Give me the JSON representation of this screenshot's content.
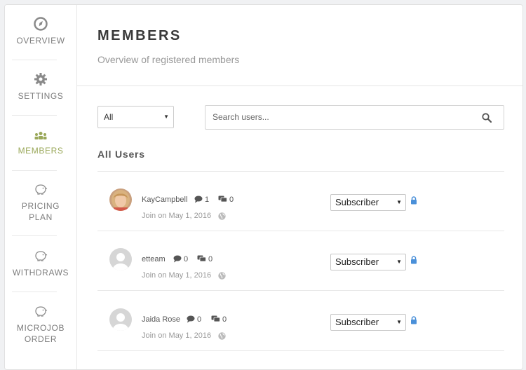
{
  "sidebar": {
    "items": [
      {
        "label": "OVERVIEW",
        "icon": "overview-icon"
      },
      {
        "label": "SETTINGS",
        "icon": "gear-icon"
      },
      {
        "label": "MEMBERS",
        "icon": "members-icon",
        "active": true
      },
      {
        "label_line1": "PRICING",
        "label_line2": "PLAN",
        "icon": "piggy-bank-icon"
      },
      {
        "label": "WITHDRAWS",
        "icon": "piggy-bank-icon"
      },
      {
        "label_line1": "MICROJOB",
        "label_line2": "ORDER",
        "icon": "piggy-bank-icon"
      }
    ]
  },
  "header": {
    "title": "MEMBERS",
    "subtitle": "Overview of registered members"
  },
  "filter": {
    "selected": "All"
  },
  "search": {
    "placeholder": "Search users..."
  },
  "section_title": "All Users",
  "users": [
    {
      "name": "KayCampbell",
      "comments": "1",
      "messages": "0",
      "joined": "Join on May 1, 2016",
      "role": "Subscriber",
      "has_photo": true
    },
    {
      "name": "etteam",
      "comments": "0",
      "messages": "0",
      "joined": "Join on May 1, 2016",
      "role": "Subscriber",
      "has_photo": false
    },
    {
      "name": "Jaida Rose",
      "comments": "0",
      "messages": "0",
      "joined": "Join on May 1, 2016",
      "role": "Subscriber",
      "has_photo": false
    }
  ],
  "colors": {
    "accent": "#9aa85a",
    "lock": "#4a90d9"
  }
}
